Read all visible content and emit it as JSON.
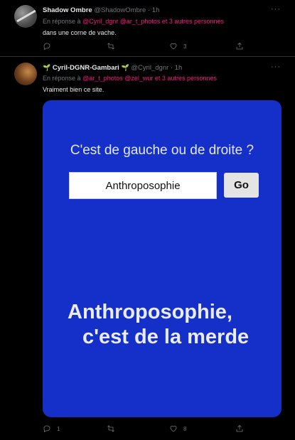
{
  "tweets": [
    {
      "display_name": "Shadow Ombre",
      "handle": "@ShadowOmbre",
      "time": "1h",
      "reply_prefix": "En réponse à",
      "mentions": [
        "@Cyril_dgnr",
        "@ar_t_photos"
      ],
      "others": "et 3 autres personnes",
      "text": "dans une corne de vache.",
      "counts": {
        "reply": "",
        "retweet": "",
        "like": "3"
      }
    },
    {
      "display_name": "Cyril-DGNR-Gambari",
      "sprout": "🌱",
      "handle": "@Cyril_dgnr",
      "time": "1h",
      "reply_prefix": "En réponse à",
      "mentions": [
        "@ar_t_photos",
        "@zel_wur"
      ],
      "others": "et 3 autres personnes",
      "text": "Vraiment bien ce site.",
      "counts": {
        "reply": "1",
        "retweet": "",
        "like": "8"
      },
      "media": {
        "question": "C'est de gauche ou de droite ?",
        "input_value": "Anthroposophie",
        "button_label": "Go",
        "verdict_line1": "Anthroposophie,",
        "verdict_line2": "c'est de la merde"
      }
    }
  ],
  "separator": "·",
  "more_label": "···",
  "icons": [
    "reply-icon",
    "retweet-icon",
    "like-icon",
    "share-icon",
    "more-icon"
  ],
  "colors": {
    "background": "#000000",
    "mention": "#f91880",
    "muted": "#71767b",
    "media_bg": "#1530c8"
  }
}
